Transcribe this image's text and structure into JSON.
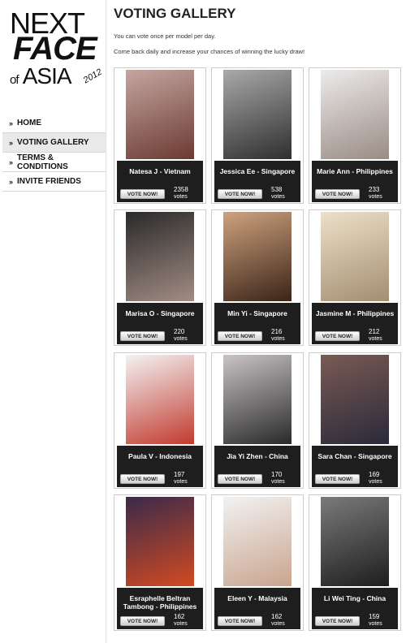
{
  "logo": {
    "line1": "NEXT",
    "line2": "FACE",
    "of": "of",
    "asia": "ASIA",
    "year": "2012"
  },
  "nav": [
    {
      "label": "HOME",
      "active": false
    },
    {
      "label": "VOTING GALLERY",
      "active": true
    },
    {
      "label": "TERMS & CONDITIONS",
      "active": false
    },
    {
      "label": "INVITE FRIENDS",
      "active": false
    }
  ],
  "page": {
    "title": "VOTING GALLERY",
    "line1": "You can vote once per model per day.",
    "line2": "Come back daily and increase your chances of winning the lucky draw!"
  },
  "button_label": "VOTE NOW!",
  "votes_label": "votes",
  "models": [
    {
      "name": "Natesa J - Vietnam",
      "votes": "2358",
      "colors": [
        "#c4a6a0",
        "#6b3a32"
      ]
    },
    {
      "name": "Jessica Ee - Singapore",
      "votes": "538",
      "colors": [
        "#a9a9a9",
        "#2e2e2e"
      ]
    },
    {
      "name": "Marie Ann - Philippines",
      "votes": "233",
      "colors": [
        "#ecebea",
        "#9a8b84"
      ]
    },
    {
      "name": "Marisa O - Singapore",
      "votes": "220",
      "colors": [
        "#2a2a2a",
        "#a28c84"
      ]
    },
    {
      "name": "Min Yi - Singapore",
      "votes": "216",
      "colors": [
        "#cfa27e",
        "#3a2418"
      ]
    },
    {
      "name": "Jasmine M - Philippines",
      "votes": "212",
      "colors": [
        "#ede0c8",
        "#a38e72"
      ]
    },
    {
      "name": "Paula V - Indonesia",
      "votes": "197",
      "colors": [
        "#f3f3f3",
        "#c23a2f"
      ]
    },
    {
      "name": "Jia Yi Zhen - China",
      "votes": "170",
      "colors": [
        "#c9c3c4",
        "#2a2a2a"
      ]
    },
    {
      "name": "Sara Chan - Singapore",
      "votes": "169",
      "colors": [
        "#7a5a54",
        "#2a2a3a"
      ]
    },
    {
      "name": "Esraphelle Beltran Tambong - Philippines",
      "votes": "162",
      "colors": [
        "#3a2a4a",
        "#d24a22"
      ]
    },
    {
      "name": "Eleen Y - Malaysia",
      "votes": "162",
      "colors": [
        "#f2f2f2",
        "#c9a48e"
      ]
    },
    {
      "name": "Li Wei Ting - China",
      "votes": "159",
      "colors": [
        "#7a7a7a",
        "#1e1e1e"
      ]
    }
  ]
}
